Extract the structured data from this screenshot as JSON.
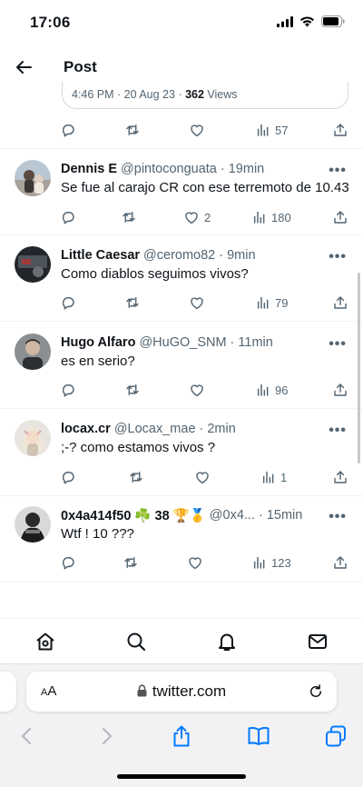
{
  "status_bar": {
    "time": "17:06"
  },
  "header": {
    "title": "Post"
  },
  "main_tweet": {
    "meta_time": "4:46 PM · 20 Aug 23 · ",
    "meta_views_count": "362",
    "meta_views_label": " Views",
    "views": "57"
  },
  "replies": [
    {
      "name": "Dennis E",
      "handle": "@pintoconguata",
      "time": "· 19min",
      "text": "Se fue al carajo CR con ese terremoto de 10.43",
      "likes": "2",
      "views": "180"
    },
    {
      "name": "Little Caesar",
      "handle": "@ceromo82",
      "time": "· 9min",
      "text": "Como diablos seguimos vivos?",
      "likes": "",
      "views": "79"
    },
    {
      "name": "Hugo Alfaro",
      "handle": "@HuGO_SNM",
      "time": "· 11min",
      "text": "es en serio?",
      "likes": "",
      "views": "96"
    },
    {
      "name": "locax.cr",
      "handle": "@Locax_mae",
      "time": "· 2min",
      "text": ";-? como estamos vivos ?",
      "likes": "",
      "views": "1"
    },
    {
      "name": "0x4a414f50 ☘️ 38 🏆🥇",
      "handle": "@0x4...",
      "time": "· 15min",
      "text": "Wtf ! 10 ???",
      "likes": "",
      "views": "123"
    }
  ],
  "more_label": "•••",
  "browser": {
    "text_size_label_small": "A",
    "text_size_label_large": "A",
    "url": "twitter.com"
  },
  "colors": {
    "text": "#0f1419",
    "muted": "#536471",
    "ios_blue": "#007aff"
  }
}
